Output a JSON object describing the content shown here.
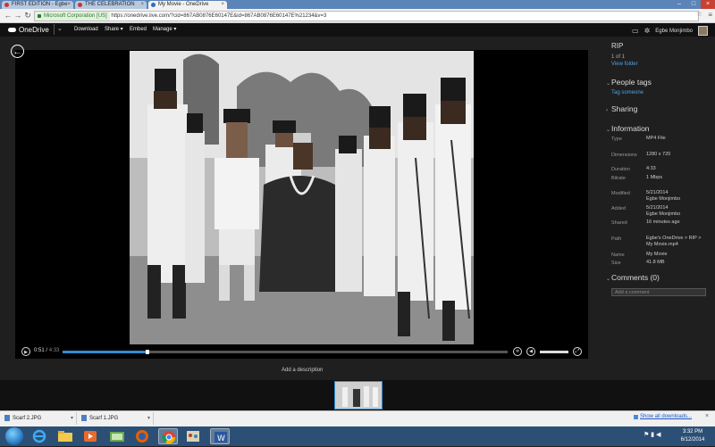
{
  "browser": {
    "tabs": [
      {
        "label": "FIRST EDITION - Egbe",
        "active": false
      },
      {
        "label": "THE CELEBRATION",
        "active": false
      },
      {
        "label": "My Movie - OneDrive",
        "active": true
      }
    ],
    "ev_label": "Microsoft Corporation [US]",
    "url": "https://onedrive.live.com/?cid=867AB0876E60147E&id=867AB0876E60147E%21234&v=3"
  },
  "onedrive": {
    "brand": "OneDrive",
    "commands": [
      "Download",
      "Share",
      "Embed",
      "Manage"
    ],
    "user_name": "Egbe Monjimbo"
  },
  "player": {
    "current_time": "0:51",
    "duration": "4:33",
    "progress_fraction": 0.19,
    "volume_fraction": 1.0,
    "add_description": "Add a description"
  },
  "panel": {
    "folder_name": "RIP",
    "position": "1 of 1",
    "view_folder": "View folder",
    "people_tags": "People tags",
    "tag_someone": "Tag someone",
    "sharing": "Sharing",
    "information": "Information",
    "info": [
      {
        "key": "Type",
        "value": "MP4 File"
      },
      {
        "key": "Dimensions",
        "value": "1280 x 720"
      },
      {
        "key": "Duration",
        "value": "4:33"
      },
      {
        "key": "Bitrate",
        "value": "1 Mbps"
      },
      {
        "key": "Modified",
        "value": "5/21/2014",
        "value2": "Egbe Monjimbo"
      },
      {
        "key": "Added",
        "value": "5/21/2014",
        "value2": "Egbe Monjimbo"
      },
      {
        "key": "Shared",
        "value": "16 minutes ago"
      },
      {
        "key": "Path",
        "value": "Egbe's OneDrive  >  RIP  >",
        "value2": "My Movie.mp4"
      },
      {
        "key": "Name",
        "value": "My Movie"
      },
      {
        "key": "Size",
        "value": "41.8 MB"
      }
    ],
    "comments": "Comments (0)",
    "comment_placeholder": "Add a comment"
  },
  "downloads": {
    "items": [
      "Scarf 2.JPG",
      "Scarf 1.JPG"
    ],
    "show_all": "Show all downloads..."
  },
  "taskbar": {
    "time": "3:32 PM",
    "date": "6/12/2014"
  }
}
